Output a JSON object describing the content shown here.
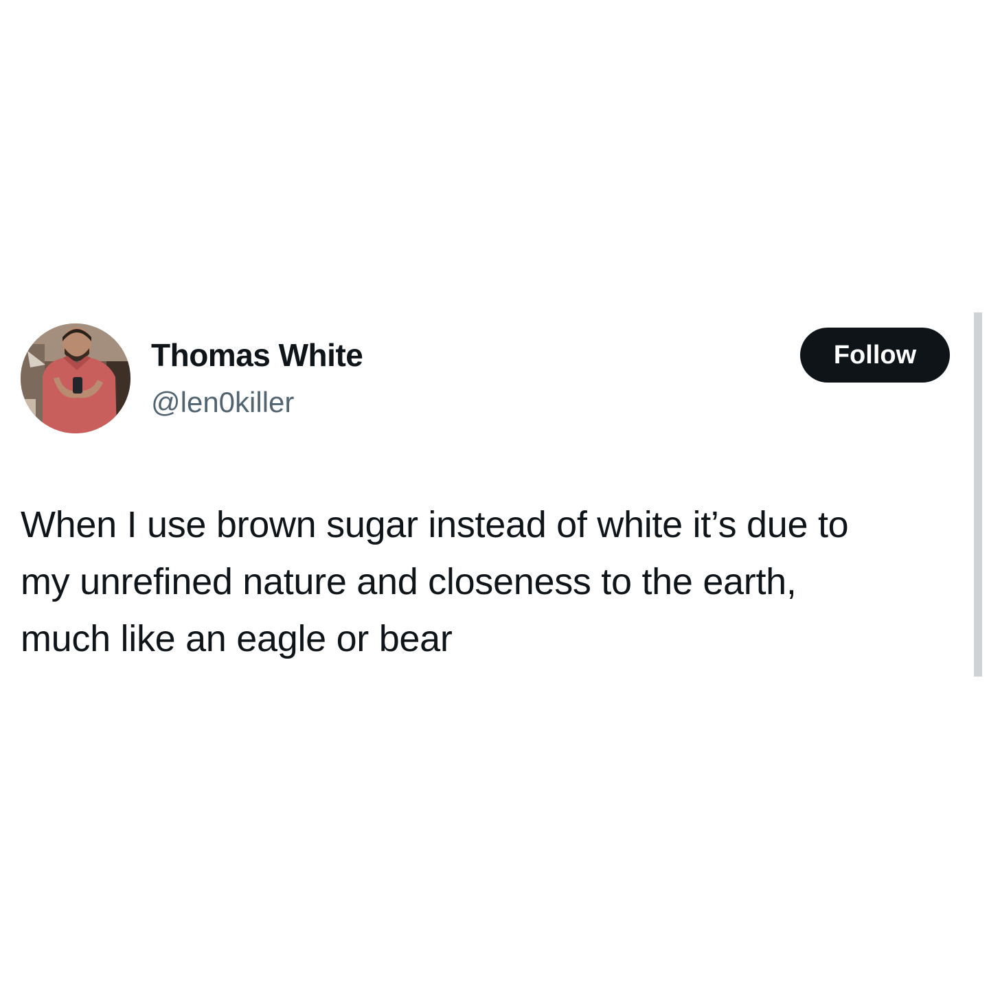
{
  "tweet": {
    "author": {
      "name": "Thomas White",
      "handle": "@len0killer",
      "avatar_icon": "profile-photo"
    },
    "follow_label": "Follow",
    "text_lines": [
      "When I use brown sugar instead of white it’s due to",
      "my unrefined nature and closeness to the earth,",
      "much like an eagle or bear"
    ]
  },
  "colors": {
    "background": "#ffffff",
    "text": "#0f1419",
    "handle": "#536471",
    "button_bg": "#0f1419",
    "button_text": "#ffffff",
    "rule": "#cfd2d5"
  }
}
